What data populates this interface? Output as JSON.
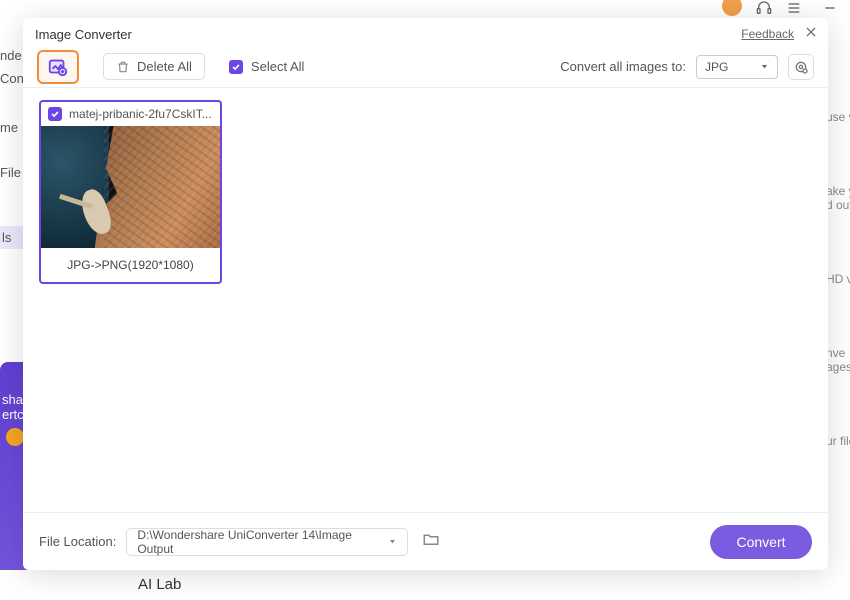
{
  "modal": {
    "title": "Image Converter",
    "feedback": "Feedback"
  },
  "toolbar": {
    "delete_all": "Delete All",
    "select_all": "Select All",
    "convert_label": "Convert all images to:",
    "format_selected": "JPG"
  },
  "thumb": {
    "filename": "matej-pribanic-2fu7CskIT...",
    "caption": "JPG->PNG(1920*1080)"
  },
  "footer": {
    "label": "File Location:",
    "path": "D:\\Wondershare UniConverter 14\\Image Output",
    "convert": "Convert"
  },
  "bg": {
    "left1": "nde",
    "left2": "Con",
    "left3": "me",
    "left4": "File",
    "left5": "ls",
    "right1": "use v",
    "right2": "ake y",
    "right3": "d out",
    "right4": "HD v",
    "right5": "nve",
    "right6": "ages",
    "right7": "ur file",
    "promo1": "shar",
    "promo2": "ertc",
    "bottom": "AI Lab"
  }
}
